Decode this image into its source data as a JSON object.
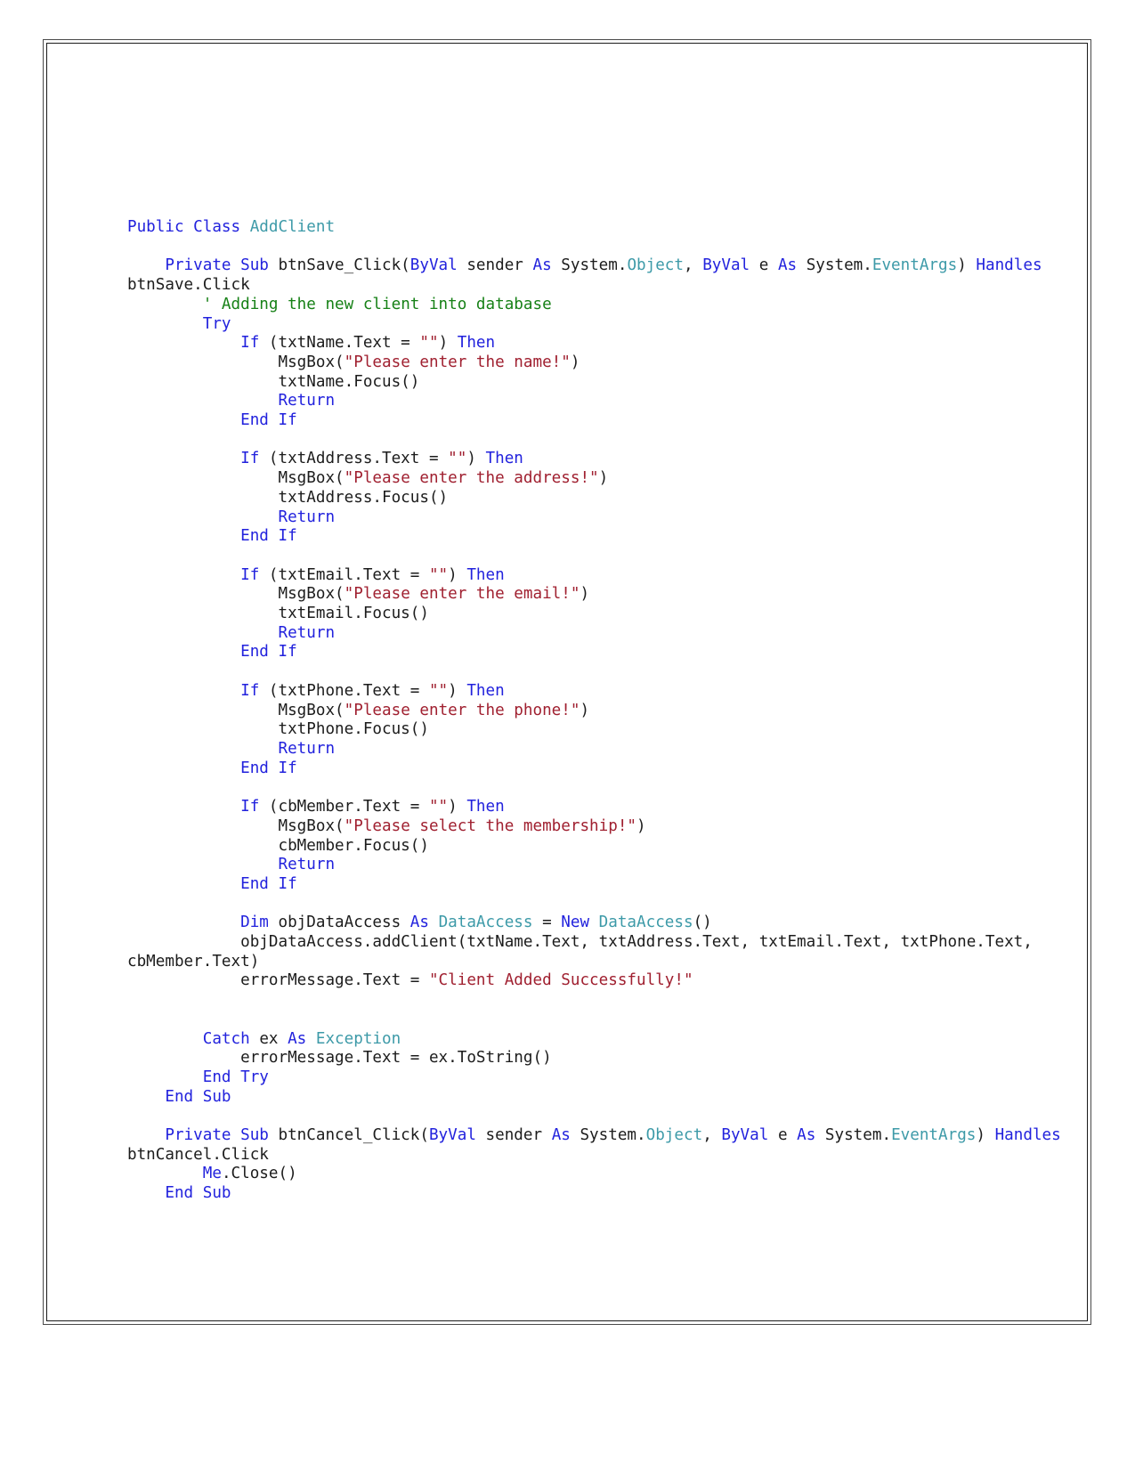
{
  "document": {
    "kind": "source-code-listing",
    "language": "VB.NET",
    "class_name": "AddClient"
  },
  "colors": {
    "keyword": "#2222dd",
    "type": "#3d9aa8",
    "string": "#a02030",
    "comment": "#178117",
    "plain": "#1c1c1c",
    "page_background": "#ffffff",
    "border_outer": "#4a4a4a",
    "border_inner": "#1a1a1a"
  },
  "code": {
    "lines": [
      [
        {
          "t": "Public Class ",
          "c": "kw"
        },
        {
          "t": "AddClient",
          "c": "typ"
        }
      ],
      [],
      [
        {
          "t": "    ",
          "c": "pln"
        },
        {
          "t": "Private Sub ",
          "c": "kw"
        },
        {
          "t": "btnSave_Click(",
          "c": "pln"
        },
        {
          "t": "ByVal ",
          "c": "kw"
        },
        {
          "t": "sender ",
          "c": "pln"
        },
        {
          "t": "As ",
          "c": "kw"
        },
        {
          "t": "System.",
          "c": "pln"
        },
        {
          "t": "Object",
          "c": "typ"
        },
        {
          "t": ", ",
          "c": "pln"
        },
        {
          "t": "ByVal ",
          "c": "kw"
        },
        {
          "t": "e ",
          "c": "pln"
        },
        {
          "t": "As ",
          "c": "kw"
        },
        {
          "t": "System.",
          "c": "pln"
        },
        {
          "t": "EventArgs",
          "c": "typ"
        },
        {
          "t": ") ",
          "c": "pln"
        },
        {
          "t": "Handles ",
          "c": "kw"
        },
        {
          "t": "btnSave.Click",
          "c": "pln"
        }
      ],
      [
        {
          "t": "        ",
          "c": "pln"
        },
        {
          "t": "' Adding the new client into database",
          "c": "cmt"
        }
      ],
      [
        {
          "t": "        ",
          "c": "pln"
        },
        {
          "t": "Try",
          "c": "kw"
        }
      ],
      [
        {
          "t": "            ",
          "c": "pln"
        },
        {
          "t": "If ",
          "c": "kw"
        },
        {
          "t": "(txtName.Text = ",
          "c": "pln"
        },
        {
          "t": "\"\"",
          "c": "str"
        },
        {
          "t": ") ",
          "c": "pln"
        },
        {
          "t": "Then",
          "c": "kw"
        }
      ],
      [
        {
          "t": "                MsgBox(",
          "c": "pln"
        },
        {
          "t": "\"Please enter the name!\"",
          "c": "str"
        },
        {
          "t": ")",
          "c": "pln"
        }
      ],
      [
        {
          "t": "                txtName.Focus()",
          "c": "pln"
        }
      ],
      [
        {
          "t": "                ",
          "c": "pln"
        },
        {
          "t": "Return",
          "c": "kw"
        }
      ],
      [
        {
          "t": "            ",
          "c": "pln"
        },
        {
          "t": "End If",
          "c": "kw"
        }
      ],
      [],
      [
        {
          "t": "            ",
          "c": "pln"
        },
        {
          "t": "If ",
          "c": "kw"
        },
        {
          "t": "(txtAddress.Text = ",
          "c": "pln"
        },
        {
          "t": "\"\"",
          "c": "str"
        },
        {
          "t": ") ",
          "c": "pln"
        },
        {
          "t": "Then",
          "c": "kw"
        }
      ],
      [
        {
          "t": "                MsgBox(",
          "c": "pln"
        },
        {
          "t": "\"Please enter the address!\"",
          "c": "str"
        },
        {
          "t": ")",
          "c": "pln"
        }
      ],
      [
        {
          "t": "                txtAddress.Focus()",
          "c": "pln"
        }
      ],
      [
        {
          "t": "                ",
          "c": "pln"
        },
        {
          "t": "Return",
          "c": "kw"
        }
      ],
      [
        {
          "t": "            ",
          "c": "pln"
        },
        {
          "t": "End If",
          "c": "kw"
        }
      ],
      [],
      [
        {
          "t": "            ",
          "c": "pln"
        },
        {
          "t": "If ",
          "c": "kw"
        },
        {
          "t": "(txtEmail.Text = ",
          "c": "pln"
        },
        {
          "t": "\"\"",
          "c": "str"
        },
        {
          "t": ") ",
          "c": "pln"
        },
        {
          "t": "Then",
          "c": "kw"
        }
      ],
      [
        {
          "t": "                MsgBox(",
          "c": "pln"
        },
        {
          "t": "\"Please enter the email!\"",
          "c": "str"
        },
        {
          "t": ")",
          "c": "pln"
        }
      ],
      [
        {
          "t": "                txtEmail.Focus()",
          "c": "pln"
        }
      ],
      [
        {
          "t": "                ",
          "c": "pln"
        },
        {
          "t": "Return",
          "c": "kw"
        }
      ],
      [
        {
          "t": "            ",
          "c": "pln"
        },
        {
          "t": "End If",
          "c": "kw"
        }
      ],
      [],
      [
        {
          "t": "            ",
          "c": "pln"
        },
        {
          "t": "If ",
          "c": "kw"
        },
        {
          "t": "(txtPhone.Text = ",
          "c": "pln"
        },
        {
          "t": "\"\"",
          "c": "str"
        },
        {
          "t": ") ",
          "c": "pln"
        },
        {
          "t": "Then",
          "c": "kw"
        }
      ],
      [
        {
          "t": "                MsgBox(",
          "c": "pln"
        },
        {
          "t": "\"Please enter the phone!\"",
          "c": "str"
        },
        {
          "t": ")",
          "c": "pln"
        }
      ],
      [
        {
          "t": "                txtPhone.Focus()",
          "c": "pln"
        }
      ],
      [
        {
          "t": "                ",
          "c": "pln"
        },
        {
          "t": "Return",
          "c": "kw"
        }
      ],
      [
        {
          "t": "            ",
          "c": "pln"
        },
        {
          "t": "End If",
          "c": "kw"
        }
      ],
      [],
      [
        {
          "t": "            ",
          "c": "pln"
        },
        {
          "t": "If ",
          "c": "kw"
        },
        {
          "t": "(cbMember.Text = ",
          "c": "pln"
        },
        {
          "t": "\"\"",
          "c": "str"
        },
        {
          "t": ") ",
          "c": "pln"
        },
        {
          "t": "Then",
          "c": "kw"
        }
      ],
      [
        {
          "t": "                MsgBox(",
          "c": "pln"
        },
        {
          "t": "\"Please select the membership!\"",
          "c": "str"
        },
        {
          "t": ")",
          "c": "pln"
        }
      ],
      [
        {
          "t": "                cbMember.Focus()",
          "c": "pln"
        }
      ],
      [
        {
          "t": "                ",
          "c": "pln"
        },
        {
          "t": "Return",
          "c": "kw"
        }
      ],
      [
        {
          "t": "            ",
          "c": "pln"
        },
        {
          "t": "End If",
          "c": "kw"
        }
      ],
      [],
      [
        {
          "t": "            ",
          "c": "pln"
        },
        {
          "t": "Dim ",
          "c": "kw"
        },
        {
          "t": "objDataAccess ",
          "c": "pln"
        },
        {
          "t": "As ",
          "c": "kw"
        },
        {
          "t": "DataAccess",
          "c": "typ"
        },
        {
          "t": " = ",
          "c": "pln"
        },
        {
          "t": "New ",
          "c": "kw"
        },
        {
          "t": "DataAccess",
          "c": "typ"
        },
        {
          "t": "()",
          "c": "pln"
        }
      ],
      [
        {
          "t": "            objDataAccess.addClient(txtName.Text, txtAddress.Text, txtEmail.Text, txtPhone.Text, cbMember.Text)",
          "c": "pln"
        }
      ],
      [
        {
          "t": "            errorMessage.Text = ",
          "c": "pln"
        },
        {
          "t": "\"Client Added Successfully!\"",
          "c": "str"
        }
      ],
      [],
      [],
      [
        {
          "t": "        ",
          "c": "pln"
        },
        {
          "t": "Catch ",
          "c": "kw"
        },
        {
          "t": "ex ",
          "c": "pln"
        },
        {
          "t": "As ",
          "c": "kw"
        },
        {
          "t": "Exception",
          "c": "typ"
        }
      ],
      [
        {
          "t": "            errorMessage.Text = ex.ToString()",
          "c": "pln"
        }
      ],
      [
        {
          "t": "        ",
          "c": "pln"
        },
        {
          "t": "End Try",
          "c": "kw"
        }
      ],
      [
        {
          "t": "    ",
          "c": "pln"
        },
        {
          "t": "End Sub",
          "c": "kw"
        }
      ],
      [],
      [
        {
          "t": "    ",
          "c": "pln"
        },
        {
          "t": "Private Sub ",
          "c": "kw"
        },
        {
          "t": "btnCancel_Click(",
          "c": "pln"
        },
        {
          "t": "ByVal ",
          "c": "kw"
        },
        {
          "t": "sender ",
          "c": "pln"
        },
        {
          "t": "As ",
          "c": "kw"
        },
        {
          "t": "System.",
          "c": "pln"
        },
        {
          "t": "Object",
          "c": "typ"
        },
        {
          "t": ", ",
          "c": "pln"
        },
        {
          "t": "ByVal ",
          "c": "kw"
        },
        {
          "t": "e ",
          "c": "pln"
        },
        {
          "t": "As ",
          "c": "kw"
        },
        {
          "t": "System.",
          "c": "pln"
        },
        {
          "t": "EventArgs",
          "c": "typ"
        },
        {
          "t": ") ",
          "c": "pln"
        },
        {
          "t": "Handles ",
          "c": "kw"
        },
        {
          "t": "btnCancel.Click",
          "c": "pln"
        }
      ],
      [
        {
          "t": "        ",
          "c": "pln"
        },
        {
          "t": "Me",
          "c": "kw"
        },
        {
          "t": ".Close()",
          "c": "pln"
        }
      ],
      [
        {
          "t": "    ",
          "c": "pln"
        },
        {
          "t": "End Sub",
          "c": "kw"
        }
      ]
    ]
  }
}
